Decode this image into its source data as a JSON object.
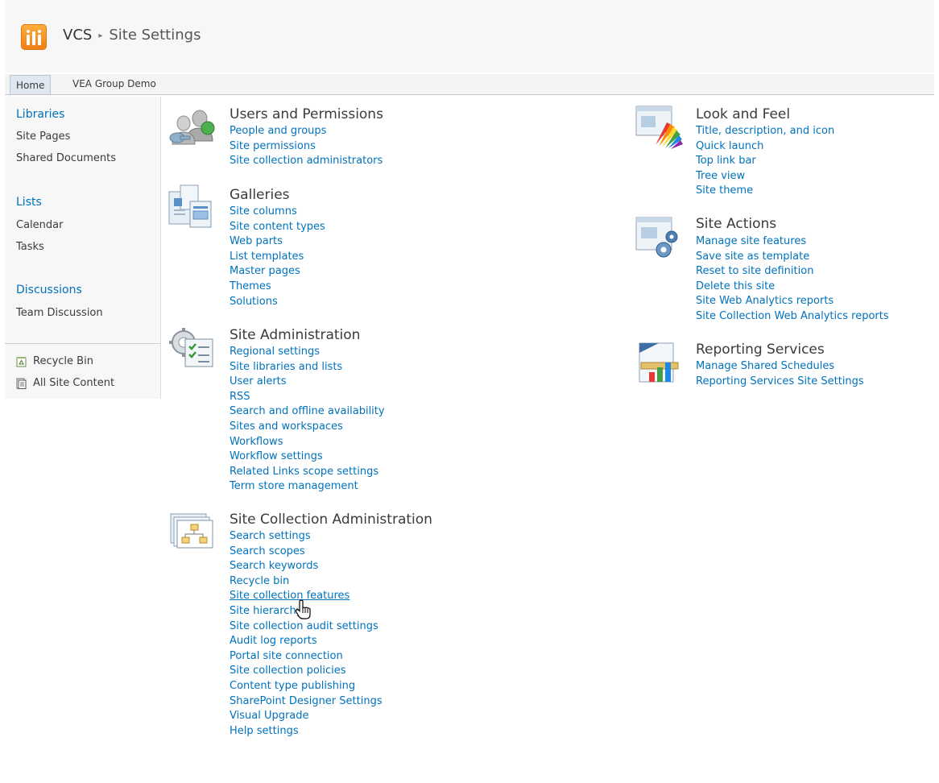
{
  "header": {
    "site_name": "VCS",
    "separator": "▸",
    "page_title": "Site Settings"
  },
  "top_nav": {
    "tabs": [
      "Home",
      "VEA Group Demo"
    ]
  },
  "quick_launch": {
    "libraries": {
      "heading": "Libraries",
      "items": [
        "Site Pages",
        "Shared Documents"
      ]
    },
    "lists": {
      "heading": "Lists",
      "items": [
        "Calendar",
        "Tasks"
      ]
    },
    "discussions": {
      "heading": "Discussions",
      "items": [
        "Team Discussion"
      ]
    },
    "bottom": [
      "Recycle Bin",
      "All Site Content"
    ]
  },
  "sections": {
    "users_permissions": {
      "title": "Users and Permissions",
      "icon": "users-permissions-icon",
      "links": [
        "People and groups",
        "Site permissions",
        "Site collection administrators"
      ]
    },
    "galleries": {
      "title": "Galleries",
      "icon": "galleries-icon",
      "links": [
        "Site columns",
        "Site content types",
        "Web parts",
        "List templates",
        "Master pages",
        "Themes",
        "Solutions"
      ]
    },
    "site_administration": {
      "title": "Site Administration",
      "icon": "site-administration-icon",
      "links": [
        "Regional settings",
        "Site libraries and lists",
        "User alerts",
        "RSS",
        "Search and offline availability",
        "Sites and workspaces",
        "Workflows",
        "Workflow settings",
        "Related Links scope settings",
        "Term store management"
      ]
    },
    "site_collection_administration": {
      "title": "Site Collection Administration",
      "icon": "site-collection-administration-icon",
      "links": [
        "Search settings",
        "Search scopes",
        "Search keywords",
        "Recycle bin",
        "Site collection features",
        "Site hierarchy",
        "Site collection audit settings",
        "Audit log reports",
        "Portal site connection",
        "Site collection policies",
        "Content type publishing",
        "SharePoint Designer Settings",
        "Visual Upgrade",
        "Help settings"
      ]
    },
    "look_and_feel": {
      "title": "Look and Feel",
      "icon": "look-and-feel-icon",
      "links": [
        "Title, description, and icon",
        "Quick launch",
        "Top link bar",
        "Tree view",
        "Site theme"
      ]
    },
    "site_actions": {
      "title": "Site Actions",
      "icon": "site-actions-icon",
      "links": [
        "Manage site features",
        "Save site as template",
        "Reset to site definition",
        "Delete this site",
        "Site Web Analytics reports",
        "Site Collection Web Analytics reports"
      ]
    },
    "reporting_services": {
      "title": "Reporting Services",
      "icon": "reporting-services-icon",
      "links": [
        "Manage Shared Schedules",
        "Reporting Services Site Settings"
      ]
    }
  },
  "cursor": {
    "type": "hand-pointer-icon",
    "hovered_link": "Site collection features"
  },
  "colors": {
    "link": "#0072bc",
    "text": "#3b3b3b",
    "logo": "#f39c1f",
    "nav_background": "#f7f7f7"
  }
}
